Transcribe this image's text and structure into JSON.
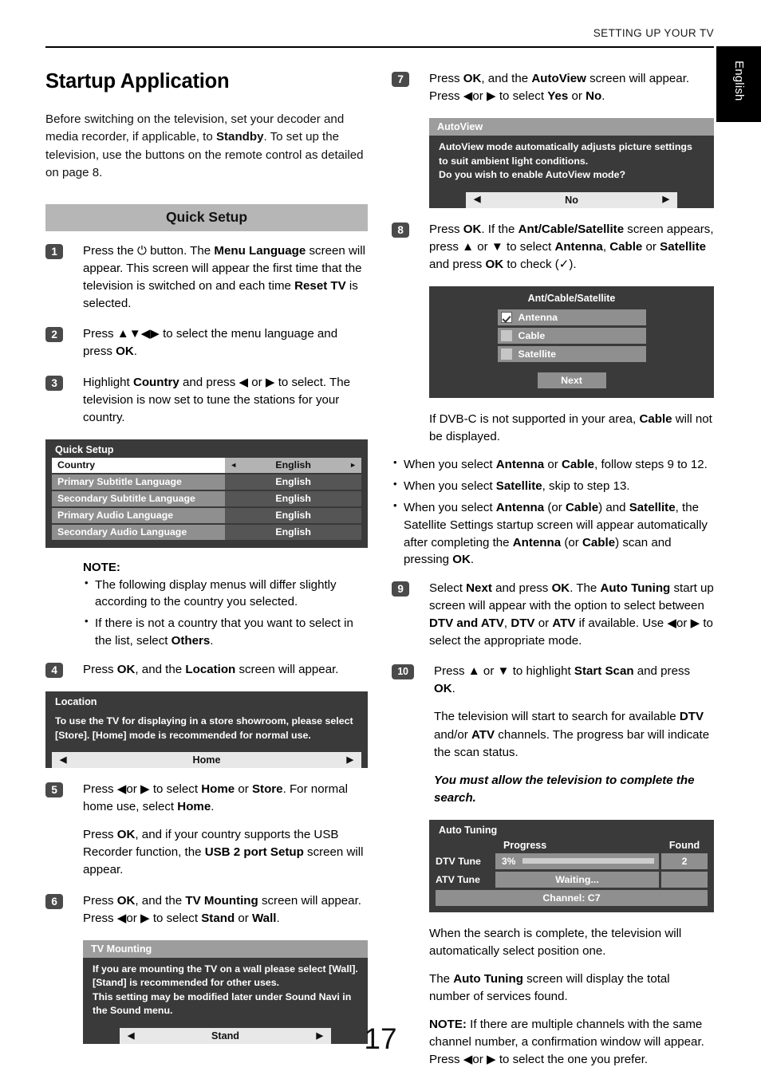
{
  "header": {
    "running_title": "SETTING UP YOUR TV",
    "language_tab": "English"
  },
  "page_number": "17",
  "left_column": {
    "title": "Startup Application",
    "intro_1": "Before switching on the television, set your decoder and media recorder, if applicable, to ",
    "intro_bold": "Standby",
    "intro_2": ". To set up the television, use the buttons on the remote control as detailed on page 8.",
    "section_band": "Quick Setup",
    "steps": [
      {
        "number": "1",
        "text_1": "Press the ",
        "power_icon": "⏻",
        "text_2": " button. The ",
        "bold_1": "Menu Language",
        "text_3": " screen will appear. This screen will appear the first time that the television is switched on and each time ",
        "bold_2": "Reset TV",
        "text_4": " is selected."
      },
      {
        "number": "2",
        "text_1": "Press ",
        "arrows": "▲▼◀▶",
        "text_2": " to select the menu language and press ",
        "bold_1": "OK",
        "text_3": "."
      },
      {
        "number": "3",
        "text_1": "Highlight ",
        "bold_1": "Country",
        "text_2": " and press ",
        "arrow_l": "◀",
        "text_3": " or ",
        "arrow_r": "▶",
        "text_4": " to select. The television is now set to tune the stations for your country."
      },
      {
        "number": "4",
        "text_1": "Press ",
        "bold_1": "OK",
        "text_2": ", and the ",
        "bold_2": "Location",
        "text_3": " screen will appear."
      },
      {
        "number": "5",
        "text_1": "Press ",
        "arrow_l": "◀",
        "text_2": "or ",
        "arrow_r": "▶",
        "text_3": " to select ",
        "bold_1": "Home",
        "text_4": " or ",
        "bold_2": "Store",
        "text_5": ". For normal home use, select ",
        "bold_3": "Home",
        "text_6": ".",
        "para2_1": "Press ",
        "para2_bold1": "OK",
        "para2_2": ", and if your country supports the USB Recorder function, the ",
        "para2_bold2": "USB 2 port Setup",
        "para2_3": " screen will appear."
      },
      {
        "number": "6",
        "text_1": "Press ",
        "bold_1": "OK",
        "text_2": ", and the ",
        "bold_2": "TV Mounting",
        "text_3": " screen will appear. Press ",
        "arrow_l": "◀",
        "text_4": "or ",
        "arrow_r": "▶",
        "text_5": " to select ",
        "bold_3": "Stand",
        "text_6": " or ",
        "bold_4": "Wall",
        "text_7": "."
      }
    ],
    "quick_setup_osd": {
      "title": "Quick Setup",
      "rows": [
        {
          "label": "Country",
          "value": "English",
          "active": true
        },
        {
          "label": "Primary Subtitle Language",
          "value": "English",
          "active": false
        },
        {
          "label": "Secondary Subtitle Language",
          "value": "English",
          "active": false
        },
        {
          "label": "Primary Audio Language",
          "value": "English",
          "active": false
        },
        {
          "label": "Secondary Audio Language",
          "value": "English",
          "active": false
        }
      ],
      "arrow_left": "◄",
      "arrow_right": "►"
    },
    "note": {
      "title": "NOTE:",
      "items_1": "The following display menus will differ slightly according to the country you selected.",
      "item2_1": "If there is not a country that you want to select in the list, select ",
      "item2_bold": "Others",
      "item2_2": "."
    },
    "location_osd": {
      "title": "Location",
      "body": "To use the TV for displaying in a store showroom, please select [Store].  [Home] mode is recommended for normal use.",
      "selected": "Home",
      "arrow_left": "◀",
      "arrow_right": "▶"
    },
    "tv_mounting_osd": {
      "title": "TV Mounting",
      "body_line1": "If you are mounting the TV on a wall please select [Wall].",
      "body_line2": "[Stand] is recommended for other uses.",
      "body_line3": "This setting may be modified later under Sound Navi in the Sound menu.",
      "selected": "Stand",
      "arrow_left": "◀",
      "arrow_right": "▶"
    }
  },
  "right_column": {
    "steps": [
      {
        "number": "7",
        "text_1": "Press ",
        "bold_1": "OK",
        "text_2": ", and the ",
        "bold_2": "AutoView",
        "text_3": " screen will appear. Press ",
        "arrow_l": "◀",
        "text_4": "or ",
        "arrow_r": "▶",
        "text_5": " to select ",
        "bold_3": "Yes",
        "text_6": " or ",
        "bold_4": "No",
        "text_7": "."
      },
      {
        "number": "8",
        "text_1": "Press ",
        "bold_1": "OK",
        "text_2": ". If the ",
        "bold_2": "Ant/Cable/Satellite",
        "text_3": " screen appears, press ",
        "arrow_u": "▲",
        "text_4": " or ",
        "arrow_d": "▼",
        "text_5": " to select ",
        "bold_3": "Antenna",
        "text_6": ", ",
        "bold_4": "Cable",
        "text_7": " or ",
        "bold_5": "Satellite",
        "text_8": " and press ",
        "bold_6": "OK",
        "text_9": " to check (",
        "check": "✓",
        "text_10": ")."
      },
      {
        "number": "9",
        "text_1": "Select ",
        "bold_1": "Next",
        "text_2": " and press ",
        "bold_2": "OK",
        "text_3": ". The ",
        "bold_3": "Auto Tuning",
        "text_4": " start up screen will appear with the option to select between ",
        "bold_4": "DTV and ATV",
        "text_5": ", ",
        "bold_5": "DTV",
        "text_6": " or ",
        "bold_6": "ATV",
        "text_7": " if available. Use ",
        "arrow_l": "◀",
        "text_8": "or ",
        "arrow_r": "▶",
        "text_9": " to select the appropriate mode."
      },
      {
        "number": "10",
        "text_1": "Press ",
        "arrow_u": "▲",
        "text_2": " or ",
        "arrow_d": "▼",
        "text_3": " to highlight ",
        "bold_1": "Start Scan",
        "text_4": " and press ",
        "bold_2": "OK",
        "text_5": ".",
        "para2_1": "The television will start to search for available ",
        "para2_bold1": "DTV",
        "para2_2": " and/or ",
        "para2_bold2": "ATV",
        "para2_3": " channels. The progress bar will indicate the scan status.",
        "para3_italic": "You must allow the television to complete the search."
      }
    ],
    "autoview_osd": {
      "title": "AutoView",
      "body_line1": "AutoView mode automatically adjusts picture settings",
      "body_line2": "to suit ambient light conditions.",
      "body_line3": "Do you wish to enable AutoView mode?",
      "selected": "No",
      "arrow_left": "◀",
      "arrow_right": "▶"
    },
    "ant_cable_sat_osd": {
      "title": "Ant/Cable/Satellite",
      "items": [
        {
          "label": "Antenna",
          "checked": true
        },
        {
          "label": "Cable",
          "checked": false
        },
        {
          "label": "Satellite",
          "checked": false
        }
      ],
      "next_button": "Next"
    },
    "dvbc_note_1": "If DVB-C is not supported in your area, ",
    "dvbc_note_bold": "Cable",
    "dvbc_note_2": " will not be displayed.",
    "bullets": [
      {
        "t1": "When you select ",
        "b1": "Antenna",
        "t2": " or ",
        "b2": "Cable",
        "t3": ", follow steps 9 to 12."
      },
      {
        "t1": "When you select ",
        "b1": "Satellite",
        "t2": ", skip to step 13.",
        "b2": "",
        "t3": ""
      },
      {
        "t1": "When you select ",
        "b1": "Antenna",
        "t2": " (or ",
        "b2": "Cable",
        "t3": ") and ",
        "b3": "Satellite",
        "t4": ", the Satellite Settings startup screen will appear automatically after completing the ",
        "b4": "Antenna",
        "t5": " (or ",
        "b5": "Cable",
        "t6": ") scan and pressing ",
        "b6": "OK",
        "t7": "."
      }
    ],
    "auto_tuning_osd": {
      "title": "Auto Tuning",
      "col_progress": "Progress",
      "col_found": "Found",
      "dtv_label": "DTV Tune",
      "dtv_percent": "3%",
      "dtv_progress_value": 3,
      "dtv_found": "2",
      "atv_label": "ATV Tune",
      "atv_status": "Waiting...",
      "atv_found": "",
      "channel": "Channel: C7"
    },
    "closing_1": "When the search is complete, the television will automatically select position one.",
    "closing_2_1": "The ",
    "closing_2_bold": "Auto Tuning",
    "closing_2_2": " screen will display the total number of services found.",
    "closing_note_bold": "NOTE:",
    "closing_note_1": " If there are multiple channels with the same channel number, a confirmation window will appear. Press ",
    "closing_note_arrow_l": "◀",
    "closing_note_2": "or ",
    "closing_note_arrow_r": "▶",
    "closing_note_3": " to select the one you prefer."
  }
}
